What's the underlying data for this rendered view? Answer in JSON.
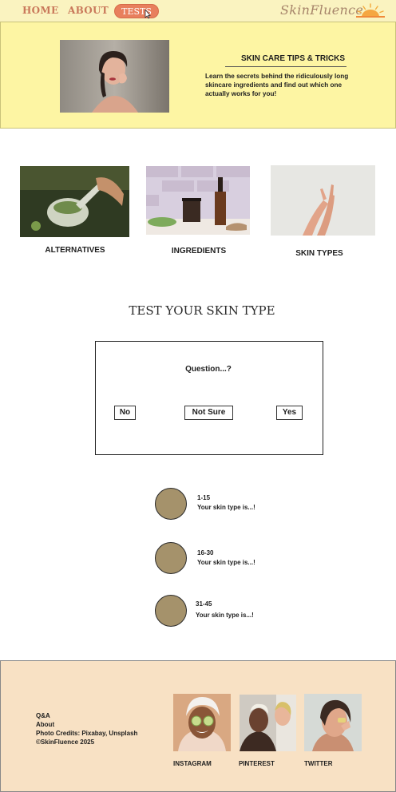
{
  "nav": {
    "home": "HOME",
    "about": "ABOUT",
    "tests": "TESTS",
    "brand": "SkinFluence"
  },
  "hero": {
    "title": "SKIN CARE TIPS & TRICKS",
    "body": "Learn the secrets behind the ridiculously long skincare ingredients and find out which one actually works for you!"
  },
  "categories": [
    {
      "label": "ALTERNATIVES"
    },
    {
      "label": "INGREDIENTS"
    },
    {
      "label": "SKIN TYPES"
    }
  ],
  "test": {
    "heading": "TEST YOUR SKIN TYPE",
    "question": "Question...?",
    "answers": [
      "No",
      "Not Sure",
      "Yes"
    ]
  },
  "results": [
    {
      "range": "1-15",
      "text": "Your skin type is...!"
    },
    {
      "range": "16-30",
      "text": "Your skin type is...!"
    },
    {
      "range": "31-45",
      "text": "Your skin type is...!"
    }
  ],
  "footer": {
    "links": [
      "Q&A",
      "About",
      "Photo Credits: Pixabay, Unsplash",
      "©SkinFluence 2025"
    ],
    "social": [
      "INSTAGRAM",
      "PINTEREST",
      "TWITTER"
    ]
  },
  "colors": {
    "nav_bg": "#faf3c0",
    "hero_bg": "#fdf5a3",
    "accent": "#e87f5d",
    "result_dot": "#a5926b",
    "footer_bg": "#f8e1c4"
  }
}
